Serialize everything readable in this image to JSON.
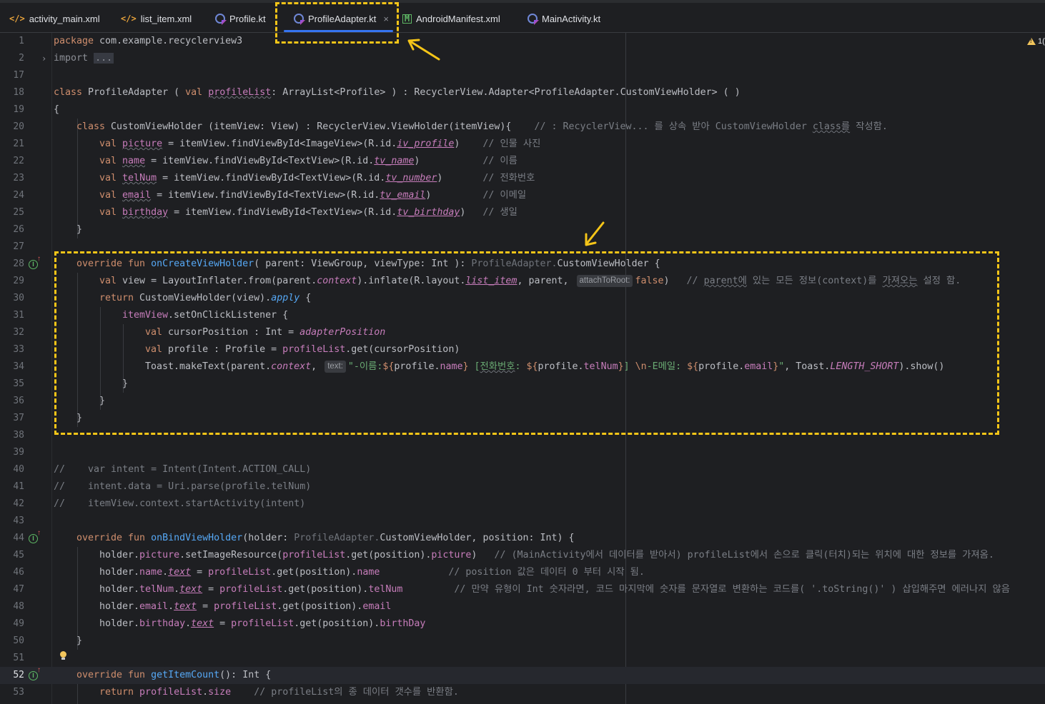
{
  "tabs": [
    {
      "label": "activity_main.xml",
      "icon": "xml-file-icon",
      "active": false
    },
    {
      "label": "list_item.xml",
      "icon": "xml-file-icon",
      "active": false
    },
    {
      "label": "Profile.kt",
      "icon": "kotlin-file-icon",
      "active": false
    },
    {
      "label": "ProfileAdapter.kt",
      "icon": "kotlin-file-icon",
      "active": true,
      "close": "×"
    },
    {
      "label": "AndroidManifest.xml",
      "icon": "manifest-file-icon",
      "active": false
    },
    {
      "label": "MainActivity.kt",
      "icon": "kotlin-file-icon",
      "active": false
    }
  ],
  "tab_icons": {
    "xml": "</>",
    "manifest": "M"
  },
  "inspection": {
    "warning_count": "1("
  },
  "colors": {
    "keyword": "#cf8e6d",
    "function": "#56a8f5",
    "property": "#c77dbb",
    "string": "#6aab73",
    "comment": "#7a7e85",
    "highlight_box": "#f5c518",
    "active_tab": "#3574f0"
  },
  "code": {
    "line_numbers": [
      "1",
      "2",
      "17",
      "18",
      "19",
      "20",
      "21",
      "22",
      "23",
      "24",
      "25",
      "26",
      "27",
      "28",
      "29",
      "30",
      "31",
      "32",
      "33",
      "34",
      "35",
      "36",
      "37",
      "38",
      "39",
      "40",
      "41",
      "42",
      "43",
      "44",
      "45",
      "46",
      "47",
      "48",
      "49",
      "50",
      "51",
      "52",
      "53"
    ],
    "current_line": "52",
    "l1": {
      "kw": "package",
      "rest": " com.example.recyclerview3"
    },
    "l2": {
      "kw": "import",
      "fold": "..."
    },
    "l18": {
      "kw": "class",
      "name": " ProfileAdapter ( ",
      "val": "val",
      "param": "profileList",
      "rest": ": ArrayList<Profile> ) : RecyclerView.Adapter<ProfileAdapter.CustomViewHolder> ( )"
    },
    "l19": "{",
    "l20": {
      "kw": "class",
      "rest": " CustomViewHolder (itemView: View) : RecyclerView.ViewHolder(itemView){",
      "cmt_a": "    // : RecyclerView... 를 상속 받아 CustomViewHolder ",
      "cmt_b": "class를",
      "cmt_c": " 작성함."
    },
    "l21": {
      "kw": "val",
      "prop": "picture",
      "mid": " = itemView.findViewById<ImageView>(R.id.",
      "id": "iv_profile",
      "end": ")",
      "cmt": "    // 인물 사진"
    },
    "l22": {
      "kw": "val",
      "prop": "name",
      "mid": " = itemView.findViewById<TextView>(R.id.",
      "id": "tv_name",
      "end": ")",
      "cmt": "           // 이름"
    },
    "l23": {
      "kw": "val",
      "prop": "telNum",
      "mid": " = itemView.findViewById<TextView>(R.id.",
      "id": "tv_number",
      "end": ")",
      "cmt": "       // 전화번호"
    },
    "l24": {
      "kw": "val",
      "prop": "email",
      "mid": " = itemView.findViewById<TextView>(R.id.",
      "id": "tv_email",
      "end": ")",
      "cmt": "         // 이메일"
    },
    "l25": {
      "kw": "val",
      "prop": "birthday",
      "mid": " = itemView.findViewById<TextView>(R.id.",
      "id": "tv_birthday",
      "end": ")",
      "cmt": "   // 생일"
    },
    "l26": "}",
    "l28": {
      "kw": "override fun",
      "fn": "onCreateViewHolder",
      "a": "( parent: ViewGroup, viewType: Int ): ",
      "grey": "ProfileAdapter.",
      "b": "CustomViewHolder {"
    },
    "l29": {
      "kw": "val",
      "a": " view = LayoutInflater.from(parent.",
      "ctx": "context",
      "b": ").inflate(R.layout.",
      "layout": "list_item",
      "c": ", parent, ",
      "hint": "attachToRoot:",
      "f": "false",
      "d": ")   ",
      "cmt_a": "// ",
      "cmt_b": "parent에",
      " cmt_c": "",
      "cmt_rest": " 있는 모든 정보(context)를 ",
      "cmt_d": "가져오는",
      "cmt_e": " 설정 함."
    },
    "l30": {
      "kw": "return",
      "a": " CustomViewHolder(view).",
      "apply": "apply",
      "b": " {"
    },
    "l31": {
      "prop": "itemView",
      "a": ".setOnClickListener {"
    },
    "l32": {
      "kw": "val",
      "a": " cursorPosition : Int = ",
      "pos": "adapterPosition"
    },
    "l33": {
      "kw": "val",
      "a": " profile : Profile = ",
      "list": "profileList",
      "b": ".get(cursorPosition)"
    },
    "l34": {
      "a": "Toast.makeText(parent.",
      "ctx": "context",
      "b": ", ",
      "hint": "text:",
      "s1": "\"-이름:",
      "t1": "${",
      "v1": "profile.",
      "p1": "name",
      "t2": "}",
      "s2": " [",
      "s2b": "전화번호",
      "s2c": ": ",
      "t3": "${",
      "v3": "profile.",
      "p3": "telNum",
      "t4": "}",
      "s3": "] ",
      "esc": "\\n",
      "s4": "-E메일: ",
      "t5": "${",
      "v5": "profile.",
      "p5": "email",
      "t6": "}",
      "s5": "\"",
      "c": ", Toast.",
      "short": "LENGTH_SHORT",
      "d": ").show()"
    },
    "l35": "}",
    "l36": "}",
    "l37": "}",
    "l40": "//    var intent = Intent(Intent.ACTION_CALL)",
    "l41": "//    intent.data = Uri.parse(profile.telNum)",
    "l42": "//    itemView.context.startActivity(intent)",
    "l44": {
      "kw": "override fun",
      "fn": "onBindViewHolder",
      "a": "(holder: ",
      "grey": "ProfileAdapter.",
      "b": "CustomViewHolder, position: Int) {"
    },
    "l45": {
      "a": "holder.",
      "p1": "picture",
      "b": ".setImageResource(",
      "list": "profileList",
      "c": ".get(position).",
      "p2": "picture",
      "d": ")",
      "cmt": "   // (MainActivity에서 데이터를 받아서) profileList에서 손으로 클릭(터치)되는 위치에 대한 정보를 가져옴."
    },
    "l46": {
      "a": "holder.",
      "p1": "name",
      "dot": ".",
      "text": "text",
      "b": " = ",
      "list": "profileList",
      "c": ".get(position).",
      "p2": "name",
      "cmt": "            // position 값은 데이터 0 부터 시작 됨."
    },
    "l47": {
      "a": "holder.",
      "p1": "telNum",
      "dot": ".",
      "text": "text",
      "b": " = ",
      "list": "profileList",
      "c": ".get(position).",
      "p2": "telNum",
      "cmt": "         // 만약 유형이 Int 숫자라면, 코드 마지막에 숫자를 문자열로 변환하는 코드를( '.toString()' ) 삽입해주면 에러나지 않음"
    },
    "l48": {
      "a": "holder.",
      "p1": "email",
      "dot": ".",
      "text": "text",
      "b": " = ",
      "list": "profileList",
      "c": ".get(position).",
      "p2": "email"
    },
    "l49": {
      "a": "holder.",
      "p1": "birthday",
      "dot": ".",
      "text": "text",
      "b": " = ",
      "list": "profileList",
      "c": ".get(position).",
      "p2": "birthDay"
    },
    "l50": "}",
    "l52": {
      "kw": "override fun",
      "fn": "getItemCount",
      "a": "(): Int {"
    },
    "l53": {
      "kw": "return",
      "list": " profileList",
      "a": ".",
      "size": "size",
      "cmt": "    // profileList의 종 데이터 갯수를 반환함."
    }
  }
}
